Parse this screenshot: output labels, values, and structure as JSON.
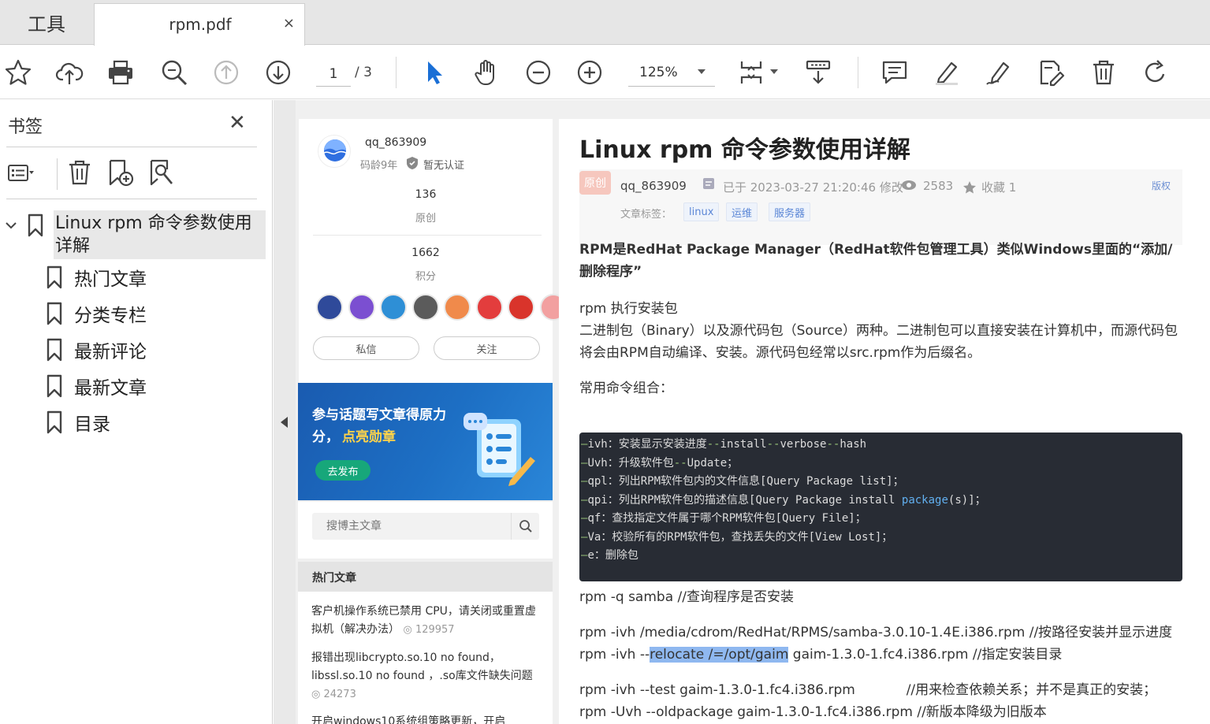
{
  "tabs": {
    "tools_label": "工具",
    "file_label": "rpm.pdf",
    "close_glyph": "×"
  },
  "toolbar": {
    "page_current": "1",
    "page_total": "/ 3",
    "zoom_value": "125%"
  },
  "bookmarks": {
    "title": "书签",
    "close_glyph": "✕",
    "root_label": "Linux rpm 命令参数使用详解",
    "children": [
      "热门文章",
      "分类专栏",
      "最新评论",
      "最新文章",
      "目录"
    ]
  },
  "profile": {
    "name": "qq_863909",
    "meta": "码龄9年",
    "cert": "暂无认证",
    "stat1_value": "136",
    "stat1_label": "原创",
    "stat2_value": "1662",
    "stat2_label": "积分",
    "btn_message": "私信",
    "btn_follow": "关注",
    "badge_colors": [
      "#2f4a9a",
      "#7b4fd1",
      "#2e8fd6",
      "#5b5b5b",
      "#f08a4b",
      "#e33d3d",
      "#d9342b",
      "#f2a0a0"
    ]
  },
  "promo": {
    "line1": "参与话题写文章得原力",
    "line2_prefix": "分，",
    "line2_highlight": "点亮勋章",
    "button": "去发布"
  },
  "search": {
    "placeholder": "搜博主文章"
  },
  "hot": {
    "title": "热门文章",
    "items": [
      {
        "text": "客户机操作系统已禁用 CPU，请关闭或重置虚拟机（解决办法）",
        "views": "129957"
      },
      {
        "text": "报错出现libcrypto.so.10 no found，libssl.so.10 no found ，.so库文件缺失问题",
        "views": "24273"
      },
      {
        "text": "开启windows10系统组策略更新，开启"
      }
    ]
  },
  "article": {
    "title": "Linux rpm 命令参数使用详解",
    "badge": "原创",
    "author": "qq_863909",
    "date": "已于 2023-03-27 21:20:46 修改",
    "views": "2583",
    "fav": "收藏 1",
    "copyright": "版权",
    "tags_label": "文章标签：",
    "tags": [
      "linux",
      "运维",
      "服务器"
    ],
    "intro": "RPM是RedHat Package Manager（RedHat软件包管理工具）类似Windows里面的“添加/删除程序”",
    "p1_line1": "rpm 执行安装包",
    "p1_line2": "二进制包（Binary）以及源代码包（Source）两种。二进制包可以直接安装在计算机中，而源代码包将会由RPM自动编译、安装。源代码包经常以src.rpm作为后缀名。",
    "p2": "常用命令组合：",
    "code": [
      {
        "opt": "ivh",
        "desc": "：安装显示安装进度",
        "tail_a": "--install--verbose--hash"
      },
      {
        "opt": "Uvh",
        "desc": "：升级软件包",
        "tail_a": "--Update；"
      },
      {
        "opt": "qpl",
        "desc": "：列出RPM软件包内的文件信息[Query Package list]；"
      },
      {
        "opt": "qpi",
        "desc": "：列出RPM软件包的描述信息[Query Package install ",
        "kw": "package",
        "tail_b": "(s)]；"
      },
      {
        "opt": "qf",
        "desc": "：查找指定文件属于哪个RPM软件包[Query File]；"
      },
      {
        "opt": "Va",
        "desc": "：校验所有的RPM软件包，查找丢失的文件[View Lost]；"
      },
      {
        "opt": "e",
        "desc": "：删除包"
      }
    ],
    "cmd1": "rpm -q samba //查询程序是否安装",
    "cmd2": "rpm -ivh /media/cdrom/RedHat/RPMS/samba-3.0.10-1.4E.i386.rpm //按路径安装并显示进度",
    "cmd3_pre": "rpm -ivh --",
    "cmd3_sel": "relocate /=/opt/gaim",
    "cmd3_post": " gaim-1.3.0-1.fc4.i386.rpm //指定安装目录",
    "cmd4": "rpm -ivh --test gaim-1.3.0-1.fc4.i386.rpm            //用来检查依赖关系；并不是真正的安装；",
    "cmd5": "rpm -Uvh --oldpackage gaim-1.3.0-1.fc4.i386.rpm //新版本降级为旧版本"
  }
}
